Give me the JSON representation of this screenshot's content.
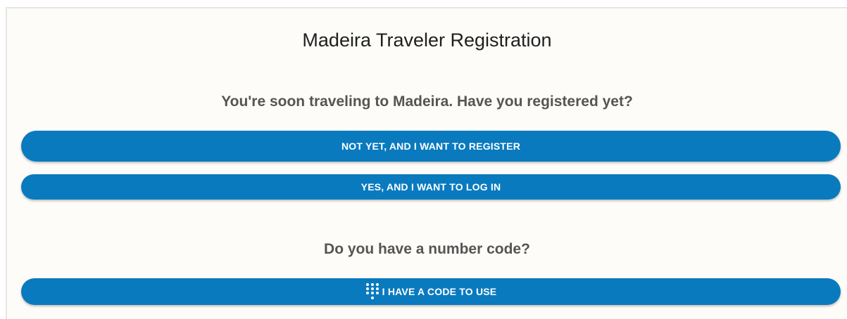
{
  "page": {
    "title": "Madeira Traveler Registration"
  },
  "registration": {
    "question": "You're soon traveling to Madeira. Have you registered yet?",
    "register_label": "NOT YET, AND I WANT TO REGISTER",
    "login_label": "YES, AND I WANT TO LOG IN"
  },
  "code": {
    "question": "Do you have a number code?",
    "button_label": "I HAVE A CODE TO USE",
    "button_icon": "dialpad-icon"
  },
  "colors": {
    "button": "#0a7abf",
    "background": "#fdfcf8",
    "question_text": "#555555"
  }
}
